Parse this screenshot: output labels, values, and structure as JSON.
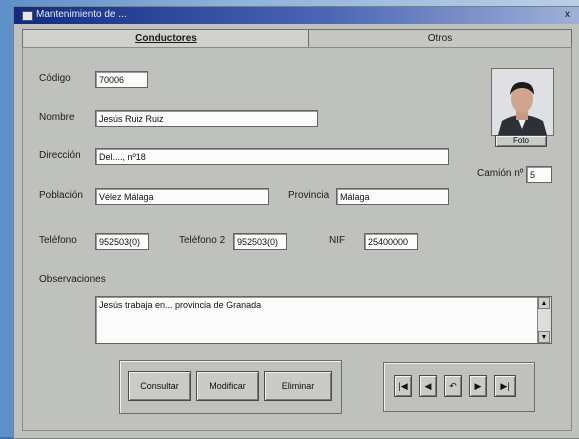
{
  "window": {
    "title": "Mantenimiento de ...",
    "close_label": "x"
  },
  "tabs": [
    {
      "label": "Conductores",
      "active": true
    },
    {
      "label": "Otros",
      "active": false
    }
  ],
  "form": {
    "codigo_label": "Código",
    "codigo_value": "70006",
    "nombre_label": "Nombre",
    "nombre_value": "Jesús Ruiz Ruiz",
    "direccion_label": "Dirección",
    "direccion_value": "Del...., nº18",
    "poblacion_label": "Población",
    "poblacion_value": "Vélez Málaga",
    "provincia_label": "Provincia",
    "provincia_value": "Málaga",
    "telefono_label": "Teléfono",
    "telefono_value": "952503(0)",
    "movil_label": "Teléfono 2",
    "movil_value": "952503(0)",
    "nif_label": "NIF",
    "nif_value": "25400000",
    "camion_label": "Camión nº",
    "camion_value": "5",
    "observaciones_label": "Observaciones",
    "observaciones_value": "Jesús trabaja en... provincia de Granada"
  },
  "photo": {
    "button_label": "Foto",
    "icon": "person-photo"
  },
  "buttons": {
    "consultar": "Consultar",
    "modificar": "Modificar",
    "eliminar": "Eliminar"
  },
  "nav": {
    "first": "|◀",
    "prev": "◀",
    "undo": "↶",
    "next": "▶",
    "last": "▶|"
  }
}
